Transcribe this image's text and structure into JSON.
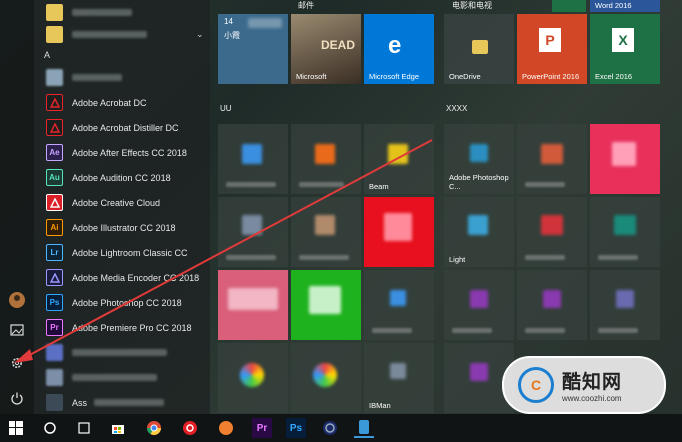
{
  "app_list": {
    "section_letter": "A",
    "items": [
      {
        "label": "Adobe Acrobat DC",
        "icon": "acrobat-icon",
        "badge": "",
        "color": "#1e1e1e",
        "fg": "#e5252a"
      },
      {
        "label": "Adobe Acrobat Distiller DC",
        "icon": "distiller-icon",
        "badge": "",
        "color": "#1e1e1e",
        "fg": "#e5252a"
      },
      {
        "label": "Adobe After Effects CC 2018",
        "icon": "after-effects-icon",
        "badge": "Ae",
        "color": "#2a1f4d",
        "fg": "#c7a6ff"
      },
      {
        "label": "Adobe Audition CC 2018",
        "icon": "audition-icon",
        "badge": "Au",
        "color": "#1b3a32",
        "fg": "#57e3bd"
      },
      {
        "label": "Adobe Creative Cloud",
        "icon": "creative-cloud-icon",
        "badge": "",
        "color": "#da1f26",
        "fg": "#ffffff"
      },
      {
        "label": "Adobe Illustrator CC 2018",
        "icon": "illustrator-icon",
        "badge": "Ai",
        "color": "#2e1d08",
        "fg": "#ff9a00"
      },
      {
        "label": "Adobe Lightroom Classic CC",
        "icon": "lightroom-icon",
        "badge": "Lr",
        "color": "#0c2333",
        "fg": "#4eb5ff"
      },
      {
        "label": "Adobe Media Encoder CC 2018",
        "icon": "media-encoder-icon",
        "badge": "",
        "color": "#1a1a3a",
        "fg": "#9999ff"
      },
      {
        "label": "Adobe Photoshop CC 2018",
        "icon": "photoshop-icon",
        "badge": "Ps",
        "color": "#061e3a",
        "fg": "#31a8ff"
      },
      {
        "label": "Adobe Premiere Pro CC 2018",
        "icon": "premiere-icon",
        "badge": "Pr",
        "color": "#1f0a3a",
        "fg": "#ea77ff"
      }
    ],
    "last_item_label": "Ass"
  },
  "groups": {
    "mail": "邮件",
    "movies_tv": "电影和电视",
    "uu": "UU",
    "xxxx": "XXXX"
  },
  "tiles": {
    "calendar_date": "14",
    "calendar_text": "小霞",
    "microsoft_label": "Microsoft",
    "edge_label": "Microsoft Edge",
    "onedrive_label": "OneDrive",
    "powerpoint_label": "PowerPoint 2016",
    "excel_label": "Excel 2016",
    "word_label": "Word 2016",
    "photoshop_label": "Adobe Photoshop C...",
    "partial_text_1": "Beam",
    "partial_text_2": "Light",
    "partial_text_3": "IBMan"
  },
  "watermark": {
    "name": "酷知网",
    "url": "www.coozhi.com",
    "logo_letter": "C"
  },
  "colors": {
    "edge_blue": "#0078d7",
    "powerpoint": "#d24726",
    "excel": "#1e7145",
    "accent_red": "#d23f31",
    "arrow_red": "#e03a3a"
  }
}
